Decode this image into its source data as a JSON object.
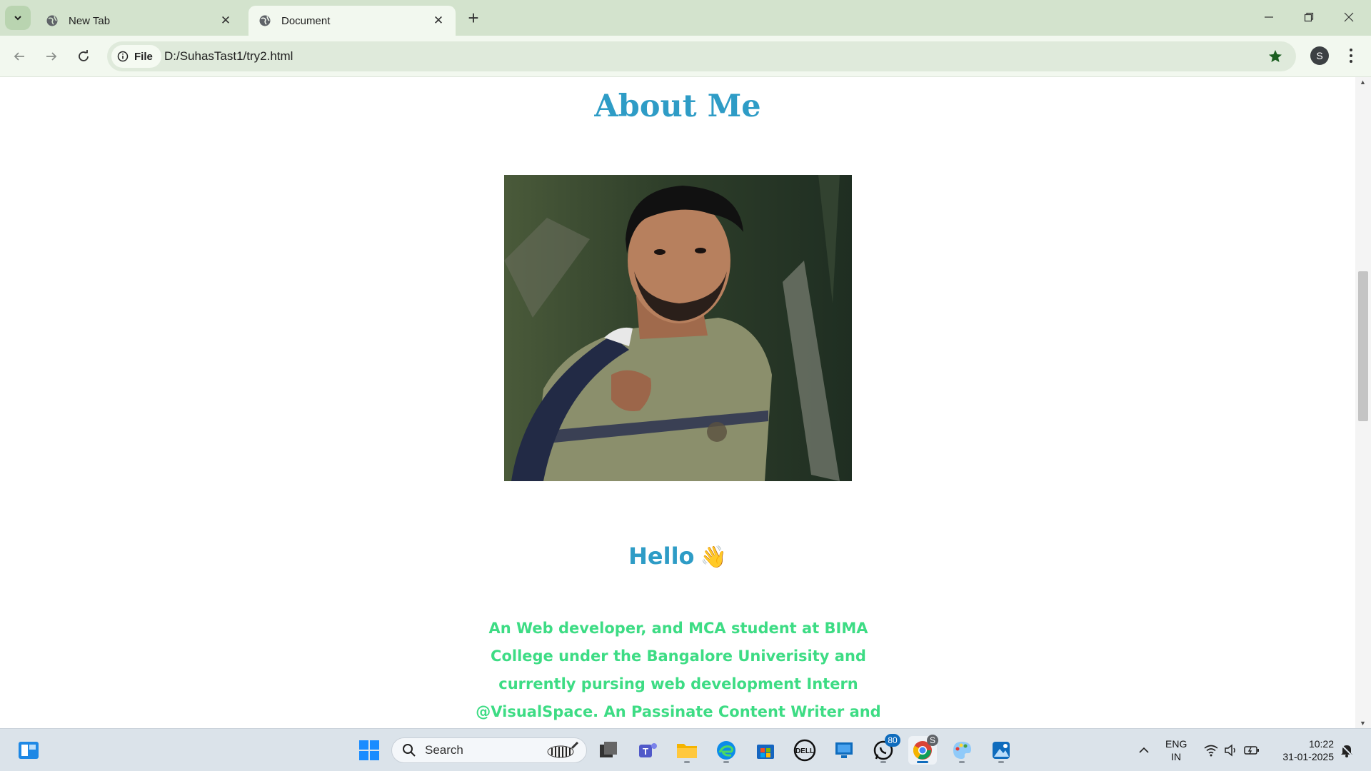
{
  "browser": {
    "tabs": [
      {
        "label": "New Tab",
        "active": false
      },
      {
        "label": "Document",
        "active": true
      }
    ],
    "new_tab_symbol": "+",
    "address": {
      "chip_label": "File",
      "url": "D:/SuhasTast1/try2.html"
    },
    "profile_initial": "S"
  },
  "page": {
    "heading": "About Me",
    "greeting": "Hello",
    "greeting_emoji": "👋",
    "bio": "An Web developer, and MCA student at BIMA College under the Bangalore Univerisity and currently pursing web development Intern @VisualSpace. An Passinate Content Writer and Graphic Designer.",
    "colors": {
      "heading": "#2e9cc6",
      "greeting": "#2e9cc6",
      "bio": "#3ddc84"
    }
  },
  "taskbar": {
    "search_placeholder": "Search",
    "whatsapp_badge": "80",
    "chrome_profile_badge": "S",
    "language": {
      "line1": "ENG",
      "line2": "IN"
    },
    "time": "10:22",
    "date": "31-01-2025"
  }
}
